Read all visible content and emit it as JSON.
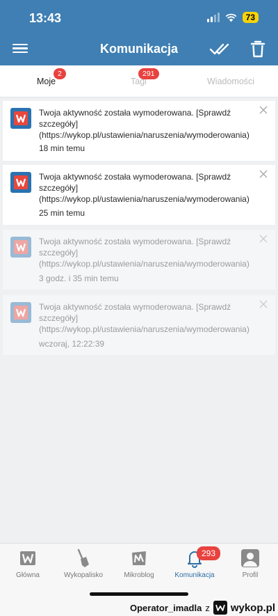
{
  "status": {
    "time": "13:43",
    "battery": "73"
  },
  "header": {
    "title": "Komunikacja"
  },
  "tabs": [
    {
      "label": "Moje",
      "badge": "2"
    },
    {
      "label": "Tagi",
      "badge": "291"
    },
    {
      "label": "Wiadomości"
    }
  ],
  "notifications": [
    {
      "text": "Twoja aktywność została wymoderowana. [Sprawdź szczegóły](https://wykop.pl/ustawienia/naruszenia/wymoderowania)",
      "time": "18 min temu"
    },
    {
      "text": "Twoja aktywność została wymoderowana. [Sprawdź szczegóły](https://wykop.pl/ustawienia/naruszenia/wymoderowania)",
      "time": "25 min temu"
    },
    {
      "text": "Twoja aktywność została wymoderowana. [Sprawdź szczegóły](https://wykop.pl/ustawienia/naruszenia/wymoderowania)",
      "time": "3 godz. i 35 min temu"
    },
    {
      "text": "Twoja aktywność została wymoderowana. [Sprawdź szczegóły](https://wykop.pl/ustawienia/naruszenia/wymoderowania)",
      "time": "wczoraj, 12:22:39"
    }
  ],
  "bottom_nav": [
    {
      "label": "Główna",
      "icon": "wykop-logo-icon"
    },
    {
      "label": "Wykopalisko",
      "icon": "shovel-icon"
    },
    {
      "label": "Mikroblog",
      "icon": "mikroblog-icon"
    },
    {
      "label": "Komunikacja",
      "icon": "bell-icon",
      "badge": "293"
    },
    {
      "label": "Profil",
      "icon": "profile-icon"
    }
  ],
  "watermark": {
    "user": "Operator_imadla",
    "separator": "z",
    "brand": "wykop.pl"
  },
  "colors": {
    "header": "#3f7fb3",
    "badge": "#e8423f",
    "active": "#2d6ea6"
  }
}
